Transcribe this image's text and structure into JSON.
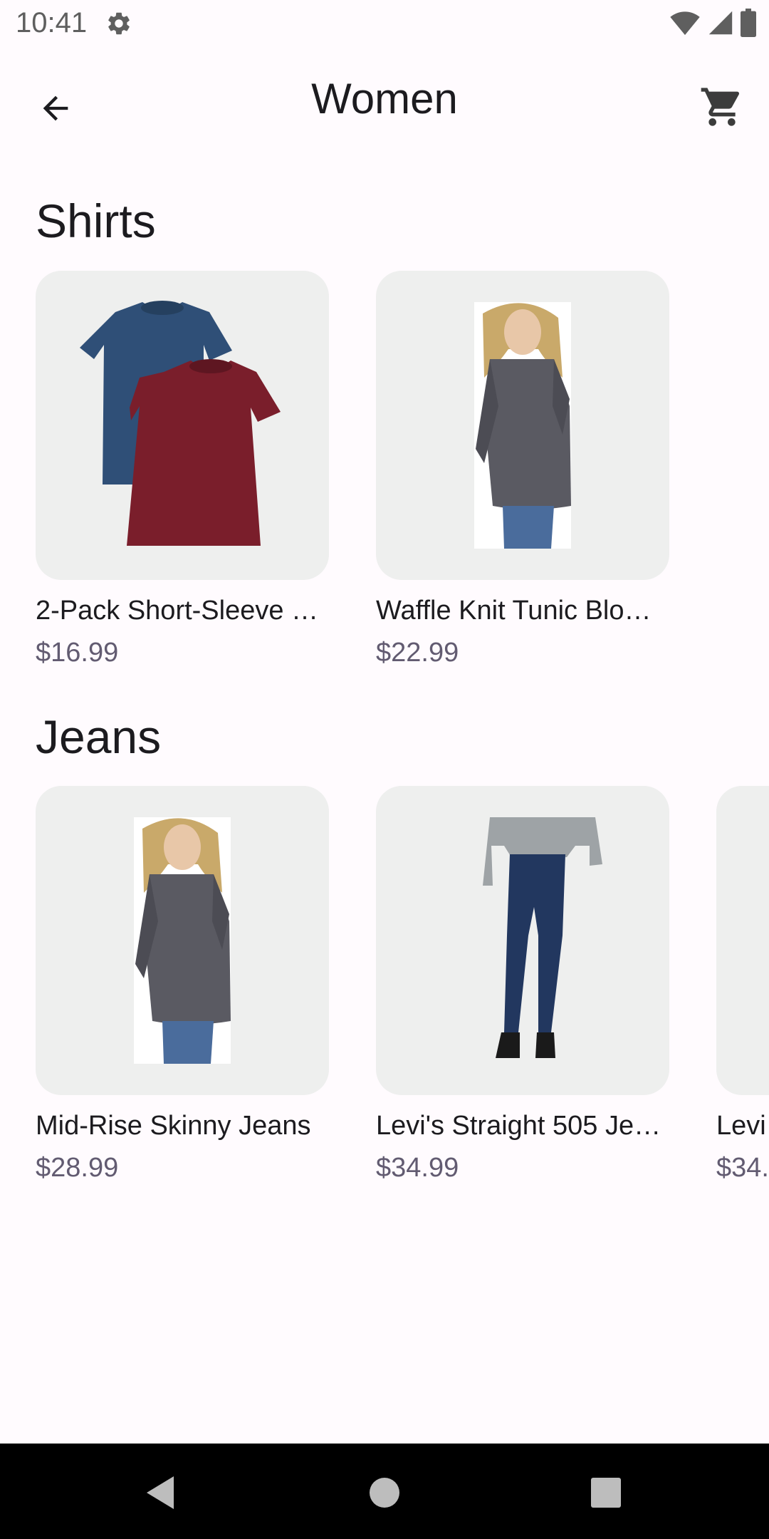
{
  "status_bar": {
    "time": "10:41",
    "icons": [
      "settings-gear-icon",
      "wifi-icon",
      "cellular-signal-icon",
      "battery-icon"
    ]
  },
  "app_bar": {
    "title": "Women",
    "back_icon": "arrow-back-icon",
    "cart_icon": "shopping-cart-icon"
  },
  "sections": [
    {
      "title": "Shirts",
      "products": [
        {
          "name": "2-Pack Short-Sleeve …",
          "price": "$16.99",
          "image": "two-tshirts"
        },
        {
          "name": "Waffle Knit Tunic Blo…",
          "price": "$22.99",
          "image": "woman-grey-tunic"
        }
      ]
    },
    {
      "title": "Jeans",
      "products": [
        {
          "name": "Mid-Rise Skinny Jeans",
          "price": "$28.99",
          "image": "woman-grey-tunic"
        },
        {
          "name": "Levi's Straight 505 Je…",
          "price": "$34.99",
          "image": "woman-jeans"
        },
        {
          "name": "Levi",
          "price": "$34.",
          "image": "partial-card"
        }
      ]
    }
  ],
  "colors": {
    "background": "#fffbfe",
    "card_background": "#eeefee",
    "text_primary": "#1c1b1f",
    "price_text": "#625b71",
    "nav_bar": "#000000"
  },
  "nav_bar": {
    "icons": [
      "nav-back-icon",
      "nav-home-icon",
      "nav-recents-icon"
    ]
  }
}
